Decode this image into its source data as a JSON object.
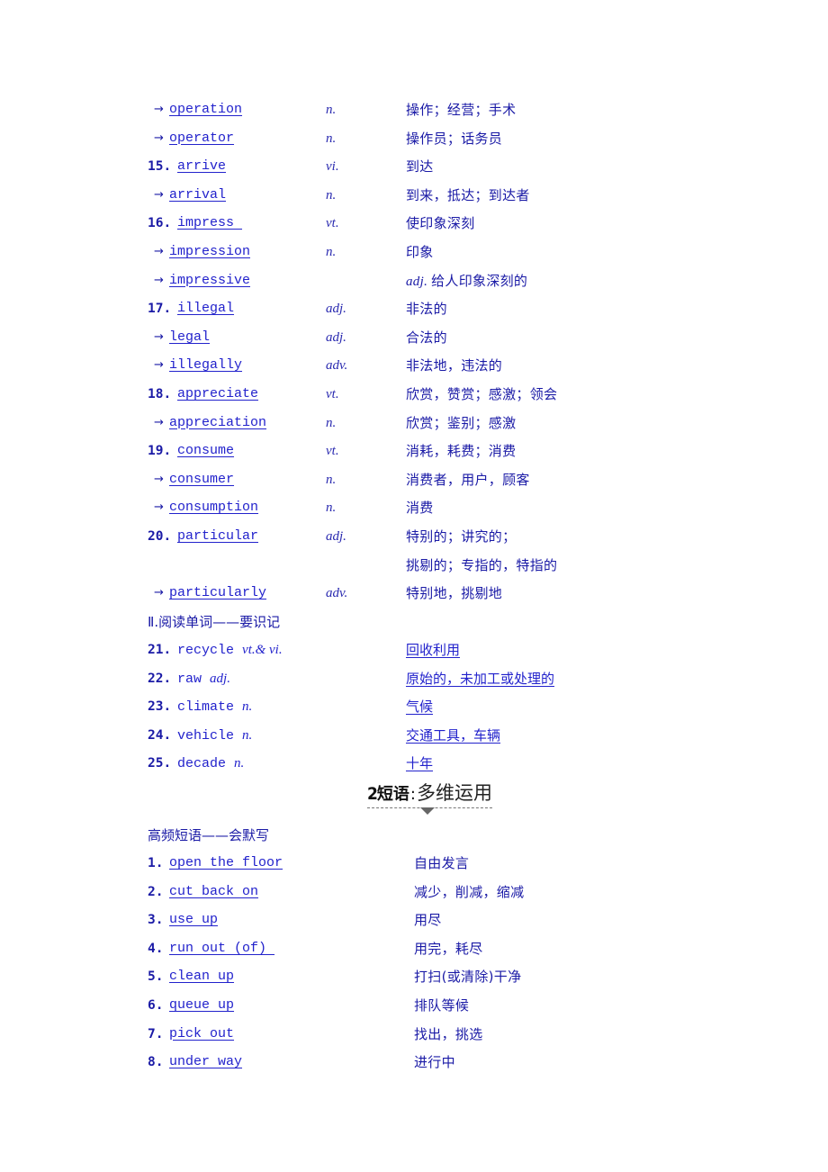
{
  "vocab_entries": [
    {
      "type": "deriv",
      "word": "operation",
      "pos": "n.",
      "meaning": "操作；经营；手术"
    },
    {
      "type": "deriv",
      "word": "operator",
      "pos": "n.",
      "meaning": "操作员；话务员"
    },
    {
      "type": "main",
      "num": "15.",
      "word": "arrive",
      "pos": "vi.",
      "meaning": "到达"
    },
    {
      "type": "deriv",
      "word": "arrival",
      "pos": "n.",
      "meaning": "到来，抵达；到达者"
    },
    {
      "type": "main",
      "num": "16.",
      "word": "impress ",
      "pos": "vt.",
      "meaning": "使印象深刻"
    },
    {
      "type": "deriv",
      "word": "impression",
      "pos": "n.",
      "meaning": "印象"
    },
    {
      "type": "deriv",
      "word": "impressive",
      "pos": "",
      "meaning_pos": "adj.",
      "meaning": "给人印象深刻的"
    },
    {
      "type": "main",
      "num": "17.",
      "word": "illegal",
      "pos": "adj.",
      "meaning": "非法的"
    },
    {
      "type": "deriv",
      "word": "legal",
      "pos": "adj.",
      "meaning": "合法的"
    },
    {
      "type": "deriv",
      "word": "illegally",
      "pos": "adv.",
      "meaning": "非法地，违法的"
    },
    {
      "type": "main",
      "num": "18.",
      "word": "appreciate",
      "pos": "vt.",
      "meaning": "欣赏，赞赏；感激；领会"
    },
    {
      "type": "deriv",
      "word": "appreciation",
      "pos": "n.",
      "meaning": "欣赏；鉴别；感激"
    },
    {
      "type": "main",
      "num": "19.",
      "word": "consume",
      "pos": "vt.",
      "meaning": "消耗，耗费；消费"
    },
    {
      "type": "deriv",
      "word": "consumer",
      "pos": "n.",
      "meaning": "消费者，用户，顾客"
    },
    {
      "type": "deriv",
      "word": "consumption",
      "pos": "n.",
      "meaning": "消费"
    },
    {
      "type": "main",
      "num": "20.",
      "word": "particular",
      "pos": "adj.",
      "meaning": "特别的；讲究的；"
    },
    {
      "type": "cont",
      "meaning": "挑剔的；专指的，特指的"
    },
    {
      "type": "deriv",
      "word": "particularly",
      "pos": "adv.",
      "meaning": "特别地，挑剔地"
    }
  ],
  "arrow_glyph": "→",
  "reading_section": {
    "label": "Ⅱ.阅读单词——要识记",
    "entries": [
      {
        "num": "21.",
        "word": "recycle",
        "pos": "vt.& vi.",
        "meaning": "回收利用"
      },
      {
        "num": "22.",
        "word": "raw",
        "pos": "adj.",
        "meaning": "原始的，未加工或处理的"
      },
      {
        "num": "23.",
        "word": "climate",
        "pos": "n.",
        "meaning": "气候"
      },
      {
        "num": "24.",
        "word": "vehicle",
        "pos": "n.",
        "meaning": "交通工具，车辆"
      },
      {
        "num": "25.",
        "word": "decade",
        "pos": "n.",
        "meaning": "十年"
      }
    ]
  },
  "section_heading": {
    "number": "2",
    "bold": "短语",
    "separator": ":",
    "rest": "多维运用"
  },
  "phrases_section": {
    "label": "高频短语——会默写",
    "entries": [
      {
        "num": "1.",
        "phrase": "open the floor",
        "meaning": "自由发言"
      },
      {
        "num": "2.",
        "phrase": "cut back on",
        "meaning": "减少，削减，缩减"
      },
      {
        "num": "3.",
        "phrase": "use up",
        "meaning": "用尽"
      },
      {
        "num": "4.",
        "phrase": "run out (of) ",
        "meaning": "用完，耗尽"
      },
      {
        "num": "5.",
        "phrase": "clean up",
        "meaning": "打扫(或清除)干净"
      },
      {
        "num": "6.",
        "phrase": "queue up",
        "meaning": "排队等候"
      },
      {
        "num": "7.",
        "phrase": "pick out",
        "meaning": "找出，挑选"
      },
      {
        "num": "8.",
        "phrase": "under way",
        "meaning": "进行中"
      }
    ]
  },
  "colors": {
    "text_blue": "#1a1aa6",
    "link_blue": "#2222cc",
    "heading_dark": "#111111"
  }
}
